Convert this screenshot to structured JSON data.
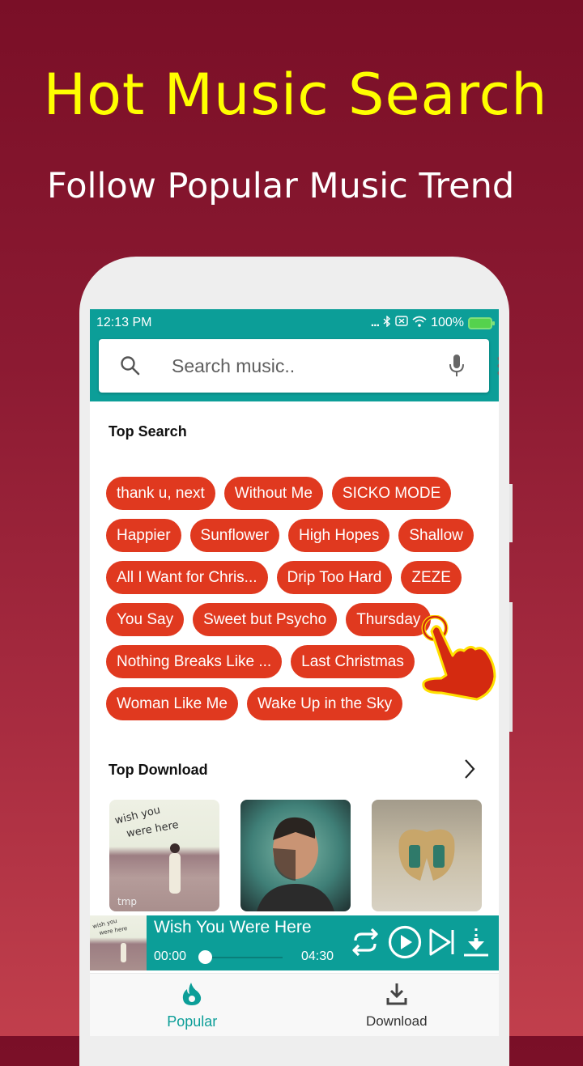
{
  "promo": {
    "headline": "Hot Music Search",
    "subheadline": "Follow Popular Music Trend"
  },
  "colors": {
    "accent": "#0c9e98",
    "chip": "#e0391f",
    "headline": "#ffff00",
    "background_top": "#7a0f27",
    "background_bottom": "#c13f4c"
  },
  "status_bar": {
    "time": "12:13 PM",
    "signal_dots": "...",
    "battery": "100%",
    "icons": [
      "bluetooth-icon",
      "no-sim-icon",
      "wifi-icon",
      "battery-charging-icon"
    ]
  },
  "search": {
    "placeholder": "Search music..",
    "value": "",
    "icons": [
      "search-icon",
      "microphone-icon",
      "more-vert-icon"
    ]
  },
  "top_search": {
    "title": "Top Search",
    "rows": [
      [
        "thank u, next",
        "Without Me",
        "SICKO MODE"
      ],
      [
        "Happier",
        "Sunflower",
        "High Hopes",
        "Shallow"
      ],
      [
        "All I Want for Chris...",
        "Drip Too Hard",
        "ZEZE"
      ],
      [
        "You Say",
        "Sweet but Psycho",
        "Thursday"
      ],
      [
        "Nothing Breaks Like ...",
        "Last Christmas"
      ],
      [
        "Woman Like Me",
        "Wake Up in the Sky"
      ]
    ]
  },
  "top_download": {
    "title": "Top Download",
    "albums": [
      {
        "name": "album-wish-you-were-here",
        "caption": "wish you were here",
        "label": "tmp"
      },
      {
        "name": "album-portrait"
      },
      {
        "name": "album-butterfly"
      }
    ]
  },
  "player": {
    "title": "Wish You Were Here",
    "current_time": "00:00",
    "duration": "04:30",
    "progress": 0,
    "thumb_caption": "wish you were here"
  },
  "bottom_nav": {
    "items": [
      {
        "label": "Popular",
        "active": true
      },
      {
        "label": "Download",
        "active": false
      }
    ]
  }
}
